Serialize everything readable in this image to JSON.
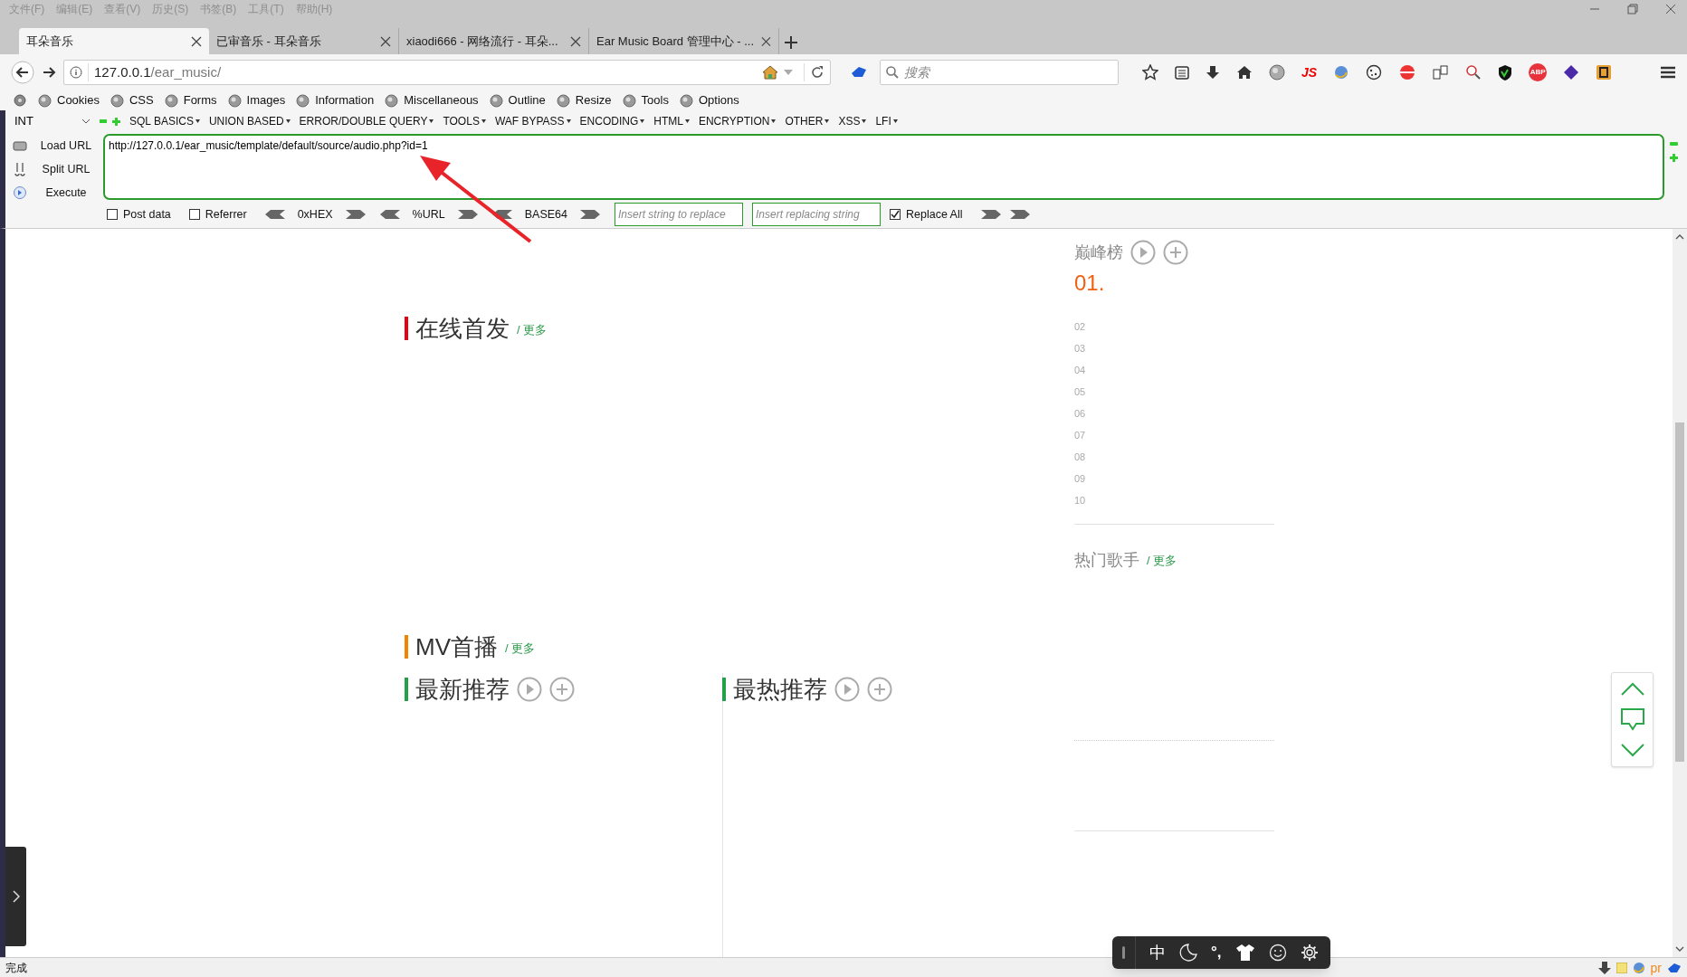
{
  "menu_bar": [
    "文件(F)",
    "编辑(E)",
    "查看(V)",
    "历史(S)",
    "书签(B)",
    "工具(T)",
    "帮助(H)"
  ],
  "tabs": [
    {
      "title": "耳朵音乐",
      "selected": true
    },
    {
      "title": "已审音乐 - 耳朵音乐",
      "selected": false
    },
    {
      "title": "xiaodi666 - 网络流行 - 耳朵...",
      "selected": false
    },
    {
      "title": "Ear Music Board 管理中心 - ...",
      "selected": false
    }
  ],
  "address_bar": {
    "host": "127.0.0.1",
    "path": "/ear_music/"
  },
  "search_box": {
    "placeholder": "搜索"
  },
  "nav_toolbar": {
    "js_label": "JS",
    "abp_label": "ABP"
  },
  "webdev_toolbar": [
    "Cookies",
    "CSS",
    "Forms",
    "Images",
    "Information",
    "Miscellaneous",
    "Outline",
    "Resize",
    "Tools",
    "Options"
  ],
  "hackbar": {
    "type_select": "INT",
    "menus": [
      "SQL BASICS",
      "UNION BASED",
      "ERROR/DOUBLE QUERY",
      "TOOLS",
      "WAF BYPASS",
      "ENCODING",
      "HTML",
      "ENCRYPTION",
      "OTHER",
      "XSS",
      "LFI"
    ],
    "actions": [
      "Load URL",
      "Split URL",
      "Execute"
    ],
    "url": "http://127.0.0.1/ear_music/template/default/source/audio.php?id=1",
    "post_data": {
      "label": "Post data",
      "checked": false
    },
    "referrer": {
      "label": "Referrer",
      "checked": false
    },
    "encoders": [
      "0xHEX",
      "%URL",
      "BASE64"
    ],
    "replace_from": {
      "placeholder": "Insert string to replace"
    },
    "replace_to": {
      "placeholder": "Insert replacing string"
    },
    "replace_all": {
      "label": "Replace All",
      "checked": true
    }
  },
  "page": {
    "online_release": {
      "title": "在线首发",
      "more": "/ 更多",
      "color": "#e60012"
    },
    "mv_premiere": {
      "title": "MV首播",
      "more": "/ 更多",
      "color": "#f08300"
    },
    "recommend": [
      {
        "title": "最新推荐",
        "color": "#22a04a"
      },
      {
        "title": "最热推荐",
        "color": "#22a04a"
      }
    ],
    "chart": {
      "title": "巅峰榜",
      "first": "01.",
      "ranks": [
        "02",
        "03",
        "04",
        "05",
        "06",
        "07",
        "08",
        "09",
        "10"
      ]
    },
    "singers": {
      "title": "热门歌手",
      "more": "/ 更多"
    }
  },
  "ime_toolbar": {
    "language": "中",
    "punctuation": "°,"
  },
  "status_bar": {
    "text": "完成",
    "addon_label": "pr"
  }
}
